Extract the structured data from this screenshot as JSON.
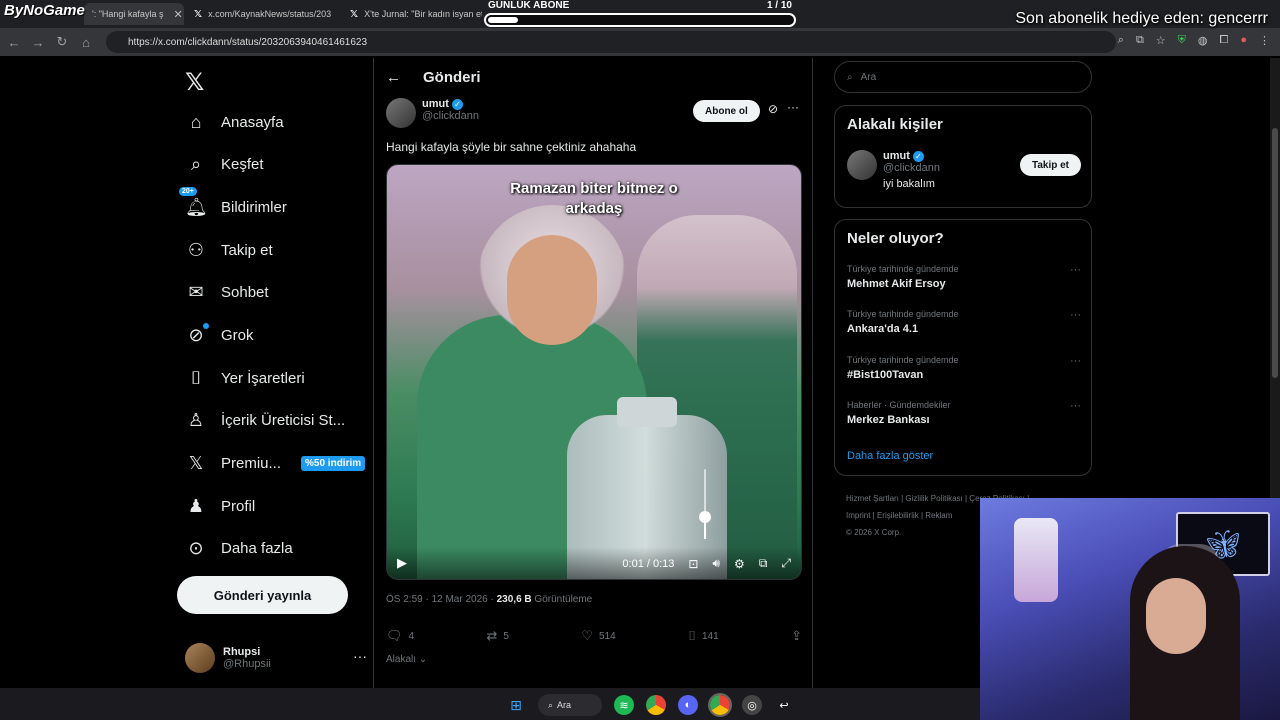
{
  "stream": {
    "brand": "ByNoGame",
    "goal_label": "GÜNLÜK ABONE",
    "goal_count": "1 / 10",
    "goal_progress": 0.1,
    "gift_banner": "Son abonelik hediye eden: gencerrr"
  },
  "browser": {
    "tabs": [
      {
        "label": "': \"Hangi kafayla ş",
        "icon": "x-logo-icon"
      },
      {
        "label": "x.com/KaynakNews/status/203",
        "icon": "x-logo-icon"
      },
      {
        "label": "X'te Jurnal: \"Bir kadın isyan etti",
        "icon": "x-logo-icon"
      }
    ],
    "url": "https://x.com/clickdann/status/2032063940461461623"
  },
  "nav": {
    "items": [
      {
        "label": "Anasayfa",
        "icon": "home-icon"
      },
      {
        "label": "Keşfet",
        "icon": "search-icon"
      },
      {
        "label": "Bildirimler",
        "icon": "bell-icon",
        "badge": "20+"
      },
      {
        "label": "Takip et",
        "icon": "follow-icon"
      },
      {
        "label": "Sohbet",
        "icon": "mail-icon"
      },
      {
        "label": "Grok",
        "icon": "grok-icon"
      },
      {
        "label": "Yer İşaretleri",
        "icon": "bookmark-icon"
      },
      {
        "label": "İçerik Üreticisi St...",
        "icon": "creator-icon"
      },
      {
        "label": "Premiu...",
        "icon": "x-logo-icon",
        "tag": "%50 indirim"
      },
      {
        "label": "Profil",
        "icon": "profile-icon"
      },
      {
        "label": "Daha fazla",
        "icon": "more-circle-icon"
      }
    ],
    "post_button": "Gönderi yayınla",
    "me": {
      "name": "Rhupsi",
      "handle": "@Rhupsii"
    }
  },
  "post": {
    "header_title": "Gönderi",
    "author_name": "umut",
    "author_handle": "@clickdann",
    "subscribe_label": "Abone ol",
    "text": "Hangi kafayla şöyle bir sahne çektiniz ahahaha",
    "video_caption_line1": "Ramazan biter bitmez o",
    "video_caption_line2": "arkadaş",
    "video_time": "0:01 / 0:13",
    "video_volume": 0.25,
    "time": "ÖS 2:59 · 12 Mar 2026 · ",
    "views": "230,6 B",
    "views_label": " Görüntüleme",
    "replies": "4",
    "reposts": "5",
    "likes": "514",
    "bookmarks": "141",
    "related_label": "Alakalı"
  },
  "sidebar": {
    "search_placeholder": "Ara",
    "related_title": "Alakalı kişiler",
    "related_user": {
      "name": "umut",
      "handle": "@clickdann",
      "bio": "iyi bakalım",
      "follow_label": "Takip et"
    },
    "trends_title": "Neler oluyor?",
    "trends": [
      {
        "context": "Türkiye tarihinde gündemde",
        "title": "Mehmet Akif Ersoy"
      },
      {
        "context": "Türkiye tarihinde gündemde",
        "title": "Ankara'da 4.1"
      },
      {
        "context": "Türkiye tarihinde gündemde",
        "title": "#Bist100Tavan"
      },
      {
        "context": "Haberler · Gündemdekiler",
        "title": "Merkez Bankası"
      }
    ],
    "show_more": "Daha fazla göster",
    "footer_line1": "Hizmet Şartları  |  Gizlilik Politikası  |  Çerez Politikası  |",
    "footer_line2": "Imprint  |  Erişilebilirlik  |  Reklam",
    "footer_line3": "© 2026 X Corp."
  },
  "taskbar": {
    "search_label": "Ara"
  }
}
